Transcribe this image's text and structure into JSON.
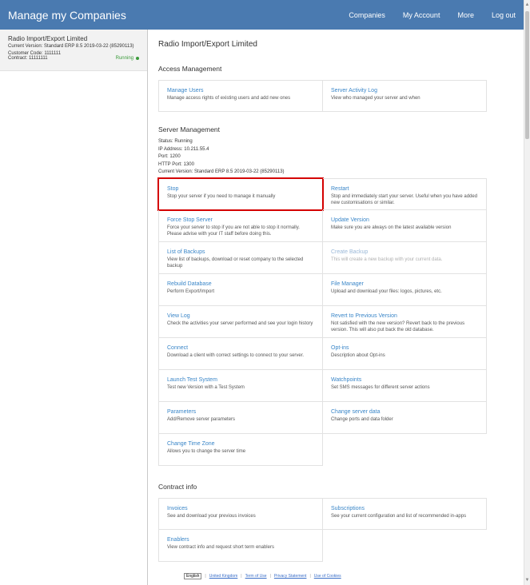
{
  "header": {
    "brand": "Manage my Companies",
    "nav": [
      "Companies",
      "My Account",
      "More",
      "Log out"
    ]
  },
  "sidebar": {
    "company_name": "Radio Import/Export Limited",
    "version": "Current Version: Standard ERP 8.5 2019-03-22 (85290113)",
    "customer_code": "Customer Code: 1111111",
    "contract": "Contract: 11111111",
    "status": "Running"
  },
  "main": {
    "title": "Radio Import/Export Limited",
    "access": {
      "title": "Access Management",
      "items": [
        {
          "title": "Manage Users",
          "desc": "Manage access rights of existing users and add new ones"
        },
        {
          "title": "Server Activity Log",
          "desc": "View who managed your server and when"
        }
      ]
    },
    "server": {
      "title": "Server Management",
      "info": [
        "Status: Running",
        "IP Address: 10.211.55.4",
        "Port: 1200",
        "HTTP Port: 1300",
        "Current Version: Standard ERP 8.5 2019-03-22 (85290113)"
      ],
      "items": [
        {
          "title": "Stop",
          "desc": "Stop your server if you need to manage it manually"
        },
        {
          "title": "Restart",
          "desc": "Stop and immediately start your server. Useful when you have added new customisations or similar."
        },
        {
          "title": "Force Stop Server",
          "desc": "Force your server to stop if you are not able to stop it normally. Please advise with your IT staff before doing this."
        },
        {
          "title": "Update Version",
          "desc": "Make sure you are always on the latest available version"
        },
        {
          "title": "List of Backups",
          "desc": "View list of backups, download or reset company to the selected backup"
        },
        {
          "title": "Create Backup",
          "desc": "This will create a new backup with your current data."
        },
        {
          "title": "Rebuild Database",
          "desc": "Perform Export/Import"
        },
        {
          "title": "File Manager",
          "desc": "Upload and download your files: logos, pictures, etc."
        },
        {
          "title": "View Log",
          "desc": "Check the activities your server performed and see your login history"
        },
        {
          "title": "Revert to Previous Version",
          "desc": "Not satisfied with the new version? Revert back to the previous version. This will also put back the old database."
        },
        {
          "title": "Connect",
          "desc": "Download a client with correct settings to connect to your server."
        },
        {
          "title": "Opt-ins",
          "desc": "Description about Opt-ins"
        },
        {
          "title": "Launch Test System",
          "desc": "Test new Version with a Test System"
        },
        {
          "title": "Watchpoints",
          "desc": "Set SMS messages for different server actions"
        },
        {
          "title": "Parameters",
          "desc": "Add/Remove server parameters"
        },
        {
          "title": "Change server data",
          "desc": "Change ports and data folder"
        },
        {
          "title": "Change Time Zone",
          "desc": "Allows you to change the server time"
        }
      ]
    },
    "contract": {
      "title": "Contract info",
      "items": [
        {
          "title": "Invoices",
          "desc": "See and download your previous invoices"
        },
        {
          "title": "Subscriptions",
          "desc": "See your current configuration and list of recommended in-apps"
        },
        {
          "title": "Enablers",
          "desc": "View contract info and request short term enablers"
        }
      ]
    }
  },
  "footer": {
    "language": "English",
    "links": [
      "United Kingdom",
      "Term of Use",
      "Privacy Statement",
      "Use of Cookies"
    ]
  },
  "colors": {
    "header_bg": "#4a7ab0",
    "link": "#3a86c8",
    "running": "#3a9a3a",
    "highlight": "#d40000"
  }
}
